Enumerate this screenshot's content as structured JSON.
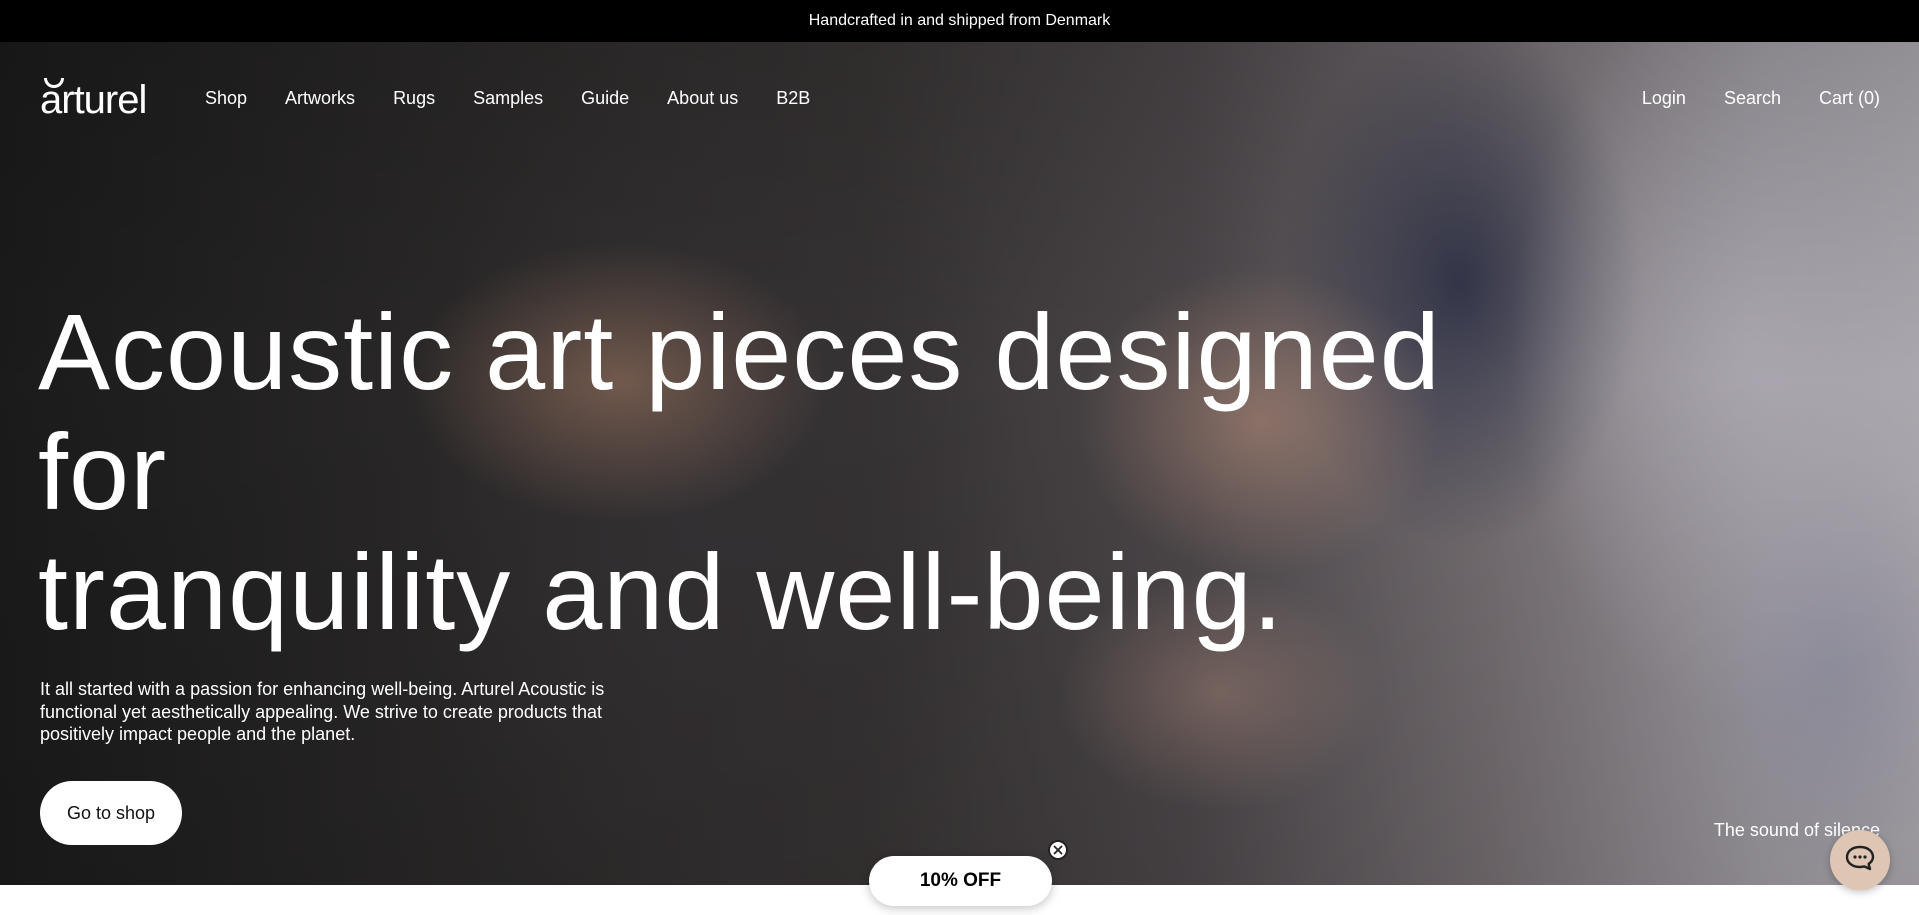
{
  "announcement": {
    "text": "Handcrafted in and shipped from Denmark"
  },
  "header": {
    "logo_text": "rturel",
    "logo_initial": "a",
    "nav": [
      {
        "label": "Shop"
      },
      {
        "label": "Artworks"
      },
      {
        "label": "Rugs"
      },
      {
        "label": "Samples"
      },
      {
        "label": "Guide"
      },
      {
        "label": "About us"
      },
      {
        "label": "B2B"
      }
    ],
    "right_nav": [
      {
        "label": "Login"
      },
      {
        "label": "Search"
      },
      {
        "label": "Cart (0)"
      }
    ]
  },
  "hero": {
    "headline_line1": "Acoustic art pieces designed for",
    "headline_line2": "tranquility and well-being.",
    "intro": "It all started with a passion for enhancing well-being. Arturel Acoustic is functional yet aesthetically appealing. We strive to create products that positively impact people and the planet.",
    "cta_label": "Go to shop",
    "caption": "The sound of silence"
  },
  "discount": {
    "label": "10% OFF"
  },
  "icons": {
    "close": "close-icon",
    "chat": "chat-icon"
  },
  "colors": {
    "announcement_bg": "#000000",
    "chat_bg": "#dec5b4"
  }
}
